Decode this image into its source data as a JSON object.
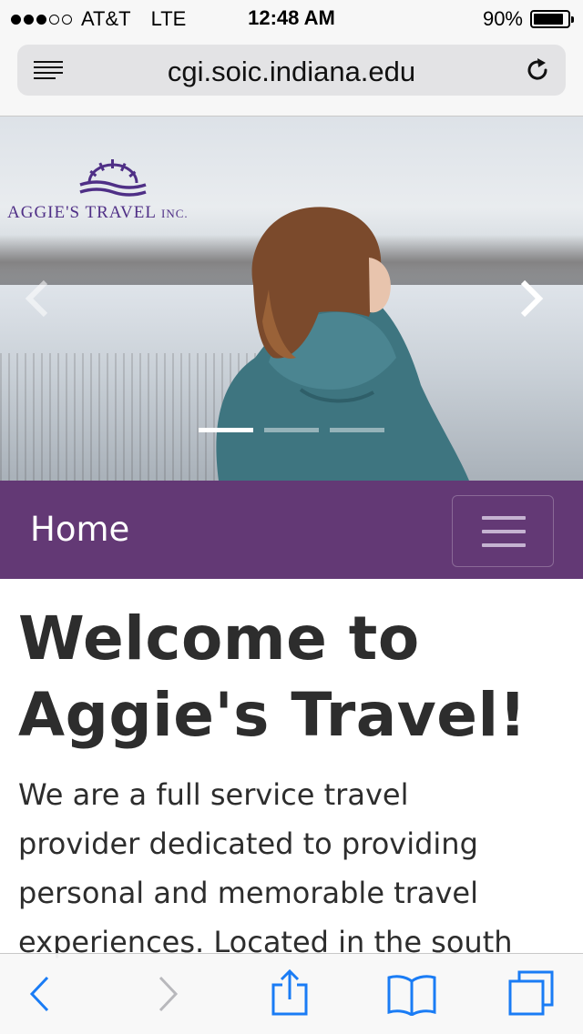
{
  "status_bar": {
    "carrier": "AT&T",
    "network": "LTE",
    "time": "12:48 AM",
    "battery_percent": "90%",
    "battery_level": 0.9,
    "signal_bars_filled": 3,
    "signal_bars_total": 5
  },
  "browser": {
    "url": "cgi.soic.indiana.edu"
  },
  "hero": {
    "logo_text": "AGGIE'S TRAVEL",
    "logo_suffix": "INC.",
    "active_slide": 1,
    "slide_count": 3
  },
  "navbar": {
    "home_label": "Home"
  },
  "main": {
    "heading_line1": "Welcome to",
    "heading_line2": "Aggie's Travel!",
    "intro_line1": "We are a full service travel",
    "intro_line2": "provider dedicated to providing",
    "intro_line3": "personal and memorable travel",
    "intro_line4": "experiences. Located in the south"
  },
  "colors": {
    "navbar": "#633975",
    "logo": "#4f2f86",
    "toolbar_accent": "#1a7cf5"
  },
  "icons": {
    "reader": "reader-mode-icon",
    "reload": "reload-icon",
    "back": "back-chevron-icon",
    "forward": "forward-chevron-icon",
    "share": "share-icon",
    "bookmarks": "bookmarks-book-icon",
    "tabs": "tabs-icon"
  }
}
